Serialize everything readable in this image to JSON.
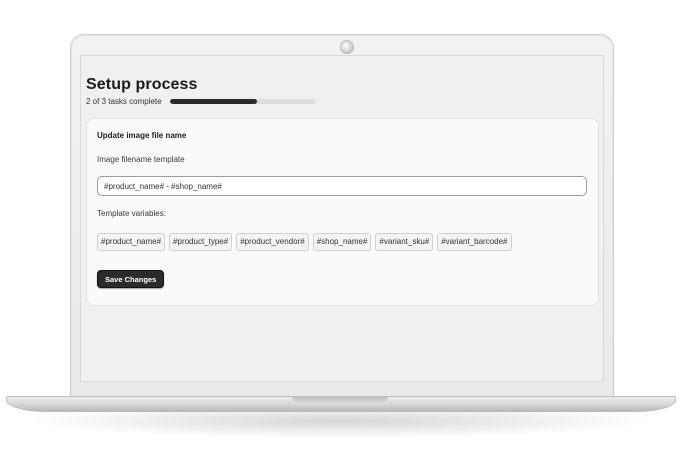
{
  "setup": {
    "title": "Setup process",
    "progress_text": "2 of 3 tasks complete",
    "progress_fraction": 0.6
  },
  "card": {
    "title": "Update image file name",
    "filename_label": "Image filename template",
    "filename_value": "#product_name# - #shop_name#",
    "variables_label": "Template variables:",
    "variables": [
      "#product_name#",
      "#product_type#",
      "#product_vendor#",
      "#shop_name#",
      "#variant_sku#",
      "#variant_barcode#"
    ],
    "save_label": "Save Changes"
  },
  "colors": {
    "progress_fill": "#2a2a2a",
    "button_bg": "#2b2b2b"
  }
}
